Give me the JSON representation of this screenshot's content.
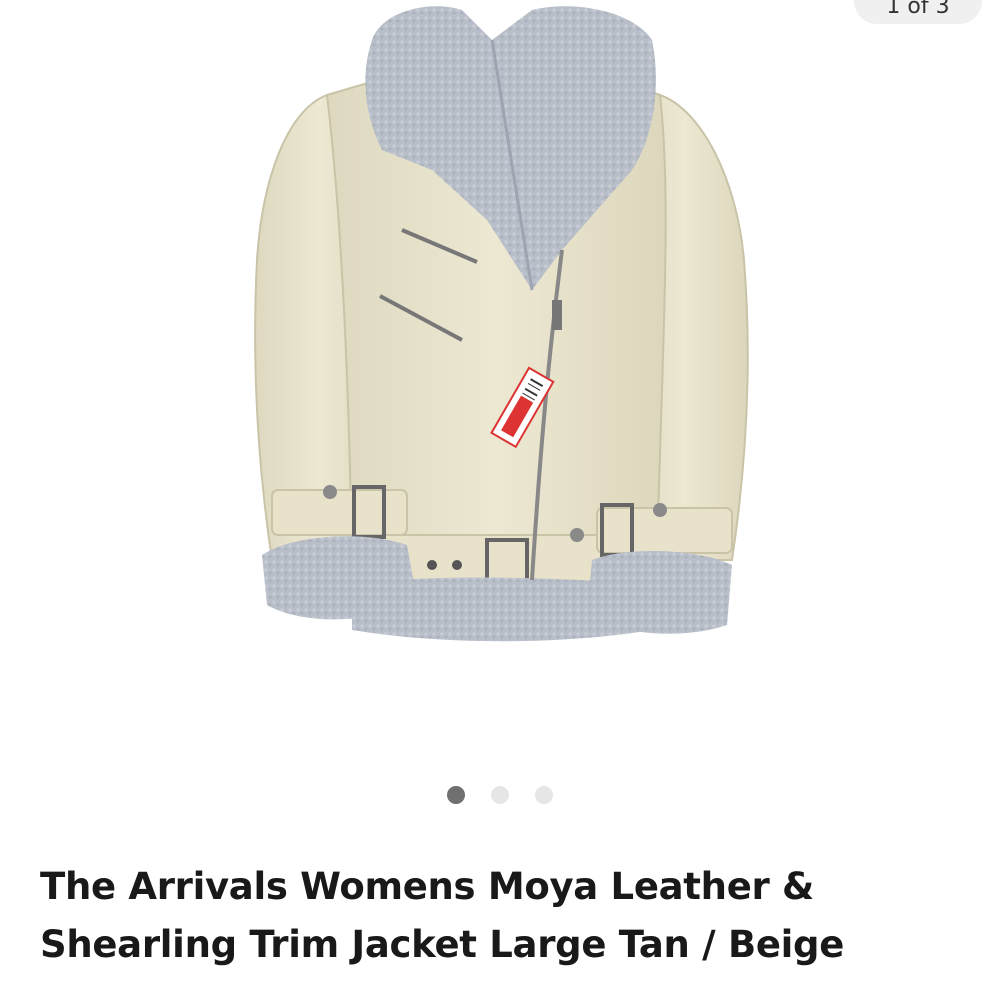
{
  "gallery": {
    "image_alt": "The Arrivals Womens Moya Leather & Shearling Trim Jacket",
    "counter_text": "1 of 3",
    "dots": [
      {
        "active": true
      },
      {
        "active": false
      },
      {
        "active": false
      }
    ]
  },
  "listing": {
    "title": "The Arrivals Womens Moya Leather & Shearling Trim Jacket Large Tan / Beige"
  },
  "colors": {
    "leather": "#ebe6cf",
    "shearling": "#b9bfc9",
    "title_text": "#191919",
    "dot_active": "#707070",
    "dot_inactive": "#e6e6e6"
  }
}
